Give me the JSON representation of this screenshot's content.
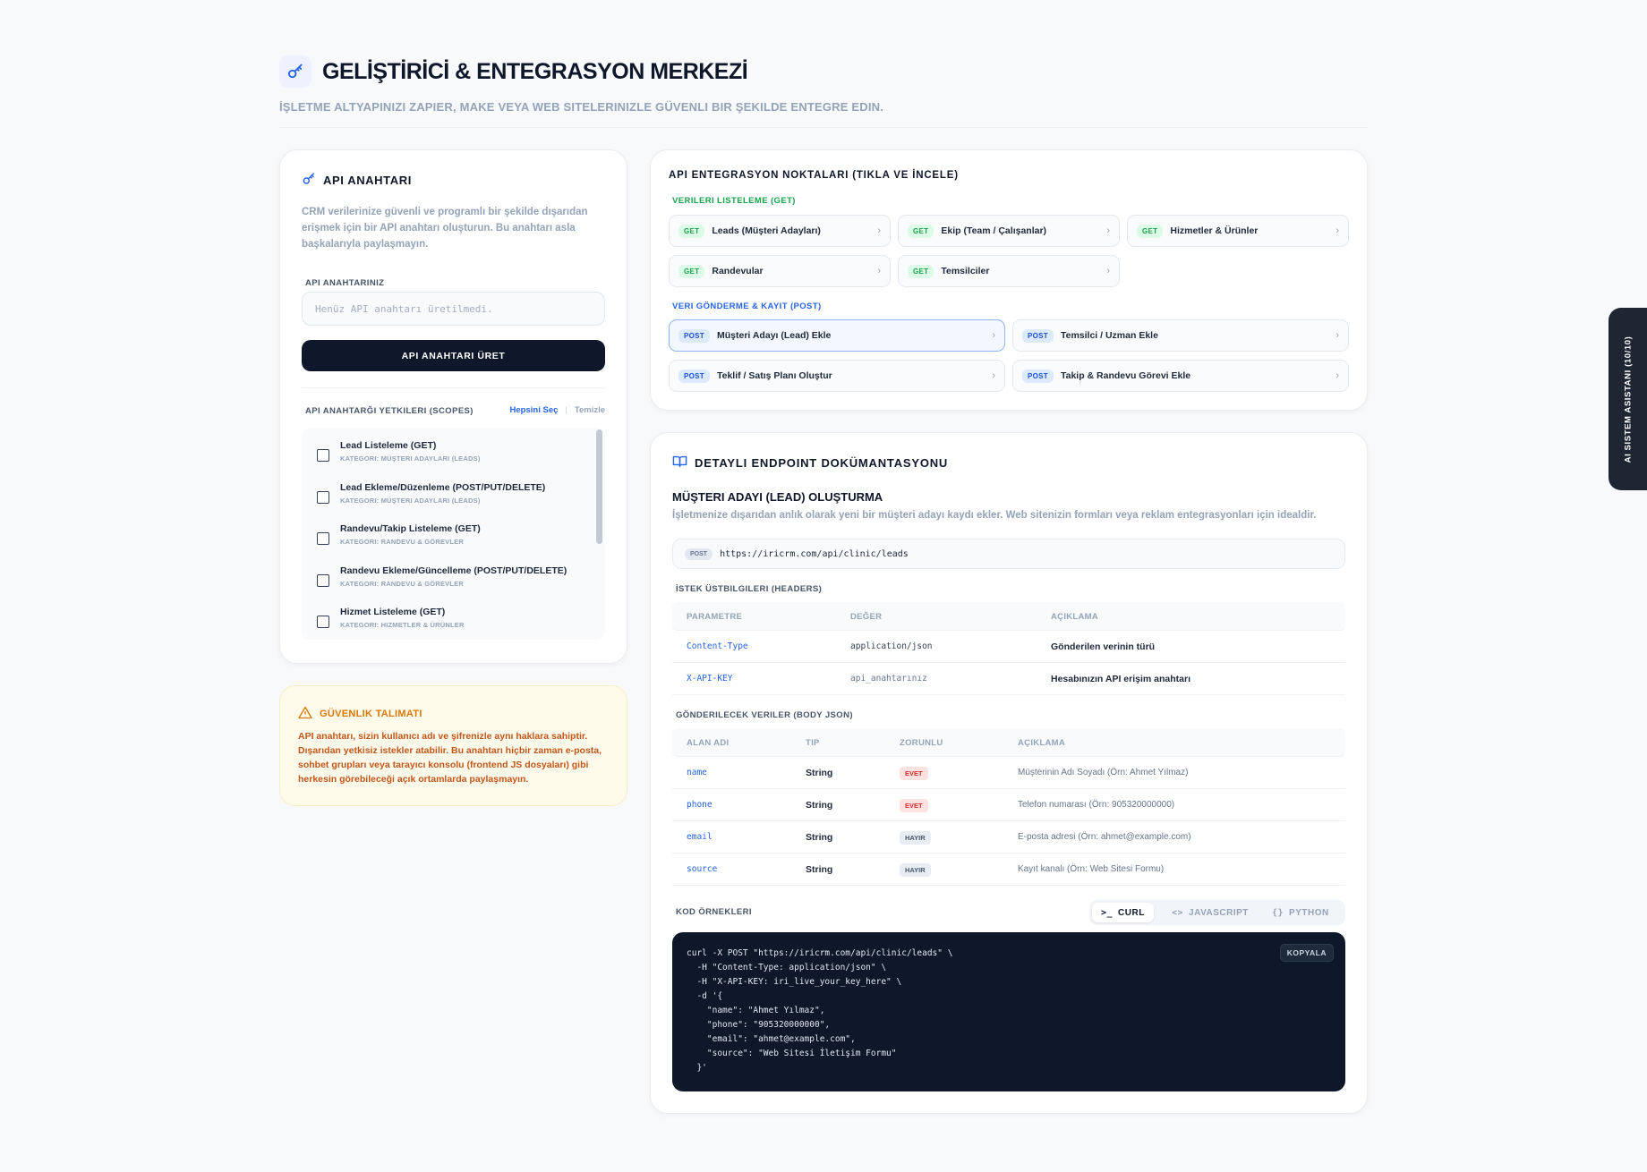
{
  "header": {
    "title": "GELİŞTİRİCİ & ENTEGRASYON MERKEZİ",
    "subtitle": "İŞLETME ALTYAPINIZI ZAPIER, MAKE VEYA WEB SITELERINIZLE GÜVENLI BIR ŞEKILDE ENTEGRE EDIN.",
    "icon": "key-icon"
  },
  "api_key": {
    "title": "API ANAHTARI",
    "description": "CRM verilerinize güvenli ve programlı bir şekilde dışarıdan erişmek için bir API anahtarı oluşturun. Bu anahtarı asla başkalarıyla paylaşmayın.",
    "keys_label": "API ANAHTARINIZ",
    "input_placeholder": "Henüz API anahtarı üretilmedi.",
    "generate_button": "API ANAHTARI ÜRET",
    "scopes_label": "API ANAHTARĞI YETKILERI (SCOPES)",
    "select_all": "Hepsini Seç",
    "clear": "Temizle",
    "scopes": [
      {
        "name": "Lead Listeleme (GET)",
        "category": "KATEGORI: MÜŞTERI ADAYLARI (LEADS)"
      },
      {
        "name": "Lead Ekleme/Düzenleme (POST/PUT/DELETE)",
        "category": "KATEGORI: MÜŞTERI ADAYLARI (LEADS)"
      },
      {
        "name": "Randevu/Takip Listeleme (GET)",
        "category": "KATEGORI: RANDEVU & GÖREVLER"
      },
      {
        "name": "Randevu Ekleme/Güncelleme (POST/PUT/DELETE)",
        "category": "KATEGORI: RANDEVU & GÖREVLER"
      },
      {
        "name": "Hizmet Listeleme (GET)",
        "category": "KATEGORI: HIZMETLER & ÜRÜNLER"
      }
    ]
  },
  "security": {
    "title": "GÜVENLIK TALIMATI",
    "text": "API anahtarı, sizin kullanıcı adı ve şifrenizle aynı haklara sahiptir. Dışarıdan yetkisiz istekler atabilir. Bu anahtarı hiçbir zaman e-posta, sohbet grupları veya tarayıcı konsolu (frontend JS dosyaları) gibi herkesin görebileceği açık ortamlarda paylaşmayın."
  },
  "endpoints": {
    "title": "API ENTEGRASYON NOKTALARI (TIKLA VE İNCELE)",
    "get_label": "VERILERI LISTELEME (GET)",
    "post_label": "VERI GÖNDERME & KAYIT (POST)",
    "get_items": [
      {
        "method": "GET",
        "label": "Leads (Müşteri Adayları)"
      },
      {
        "method": "GET",
        "label": "Ekip (Team / Çalışanlar)"
      },
      {
        "method": "GET",
        "label": "Hizmetler & Ürünler"
      },
      {
        "method": "GET",
        "label": "Randevular"
      },
      {
        "method": "GET",
        "label": "Temsilciler"
      }
    ],
    "post_items": [
      {
        "method": "POST",
        "label": "Müşteri Adayı (Lead) Ekle"
      },
      {
        "method": "POST",
        "label": "Temsilci / Uzman Ekle"
      },
      {
        "method": "POST",
        "label": "Teklif / Satış Planı Oluştur"
      },
      {
        "method": "POST",
        "label": "Takip & Randevu Görevi Ekle"
      }
    ]
  },
  "docs": {
    "title": "DETAYLI ENDPOINT DOKÜMANTASYONU",
    "endpoint_title": "MÜŞTERI ADAYI (LEAD) OLUŞTURMA",
    "endpoint_desc": "İşletmenize dışarıdan anlık olarak yeni bir müşteri adayı kaydı ekler. Web sitenizin formları veya reklam entegrasyonları için idealdir.",
    "method": "POST",
    "url": "https://iricrm.com/api/clinic/leads",
    "headers_label": "İSTEK ÜSTBILGILERI (HEADERS)",
    "headers_cols": [
      "PARAMETRE",
      "DEĞER",
      "AÇIKLAMA"
    ],
    "headers_rows": [
      {
        "param": "Content-Type",
        "value": "application/json",
        "desc": "Gönderilen verinin türü"
      },
      {
        "param": "X-API-KEY",
        "value": "api_anahtarınız",
        "desc": "Hesabınızın API erişim anahtarı"
      }
    ],
    "body_label": "GÖNDERILECEK VERILER (BODY JSON)",
    "body_cols": [
      "ALAN ADI",
      "TIP",
      "ZORUNLU",
      "AÇIKLAMA"
    ],
    "body_rows": [
      {
        "field": "name",
        "type": "String",
        "required": "EVET",
        "desc": "Müşterinin Adı Soyadı (Örn: Ahmet Yılmaz)"
      },
      {
        "field": "phone",
        "type": "String",
        "required": "EVET",
        "desc": "Telefon numarası (Örn: 905320000000)"
      },
      {
        "field": "email",
        "type": "String",
        "required": "HAYIR",
        "desc": "E-posta adresi (Örn: ahmet@example.com)"
      },
      {
        "field": "source",
        "type": "String",
        "required": "HAYIR",
        "desc": "Kayıt kanalı (Örn: Web Sitesi Formu)"
      }
    ],
    "code_label": "KOD ÖRNEKLERI",
    "tabs": [
      {
        "label": "CURL",
        "icon": "terminal-icon",
        "glyph": ">_"
      },
      {
        "label": "JAVASCRIPT",
        "icon": "code-icon",
        "glyph": "<>"
      },
      {
        "label": "PYTHON",
        "icon": "braces-icon",
        "glyph": "{}"
      }
    ],
    "copy_button": "KOPYALA",
    "code_lines": [
      "curl -X POST \"https://iricrm.com/api/clinic/leads\" \\",
      "  -H \"Content-Type: application/json\" \\",
      "  -H \"X-API-KEY: iri_live_your_key_here\" \\",
      "  -d '{",
      "    \"name\": \"Ahmet Yılmaz\",",
      "    \"phone\": \"905320000000\",",
      "    \"email\": \"ahmet@example.com\",",
      "    \"source\": \"Web Sitesi İletişim Formu\"",
      "  }'"
    ]
  },
  "ai_tab": {
    "label": "AI SISTEM ASISTANI (10/10)"
  },
  "colors": {
    "accent": "#2563eb",
    "dark": "#0f172a",
    "get": "#16a34a",
    "post": "#1d4ed8",
    "warning": "#d97706"
  }
}
